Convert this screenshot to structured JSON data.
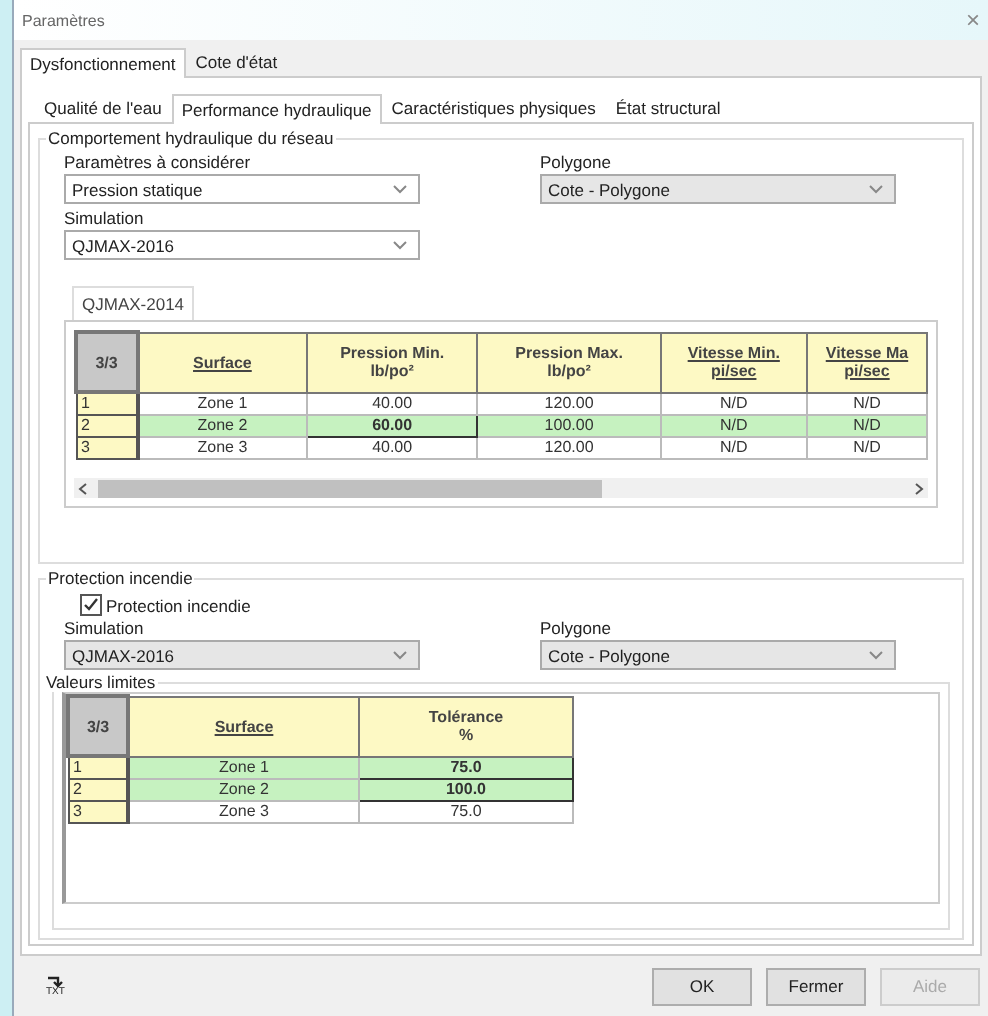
{
  "window": {
    "title": "Paramètres",
    "close": "×"
  },
  "tabs": [
    {
      "label": "Dysfonctionnement",
      "selected": true
    },
    {
      "label": "Cote d'état",
      "selected": false
    }
  ],
  "subtabs": [
    {
      "label": "Qualité de l'eau",
      "selected": false
    },
    {
      "label": "Performance hydraulique",
      "selected": true
    },
    {
      "label": "Caractéristiques physiques",
      "selected": false
    },
    {
      "label": "État structural",
      "selected": false
    }
  ],
  "hydraulic": {
    "title": "Comportement hydraulique du réseau",
    "params": {
      "label": "Paramètres à considérer",
      "value": "Pression statique",
      "disabled": false
    },
    "polygon": {
      "label": "Polygone",
      "value": "Cote - Polygone",
      "disabled": true
    },
    "simulation": {
      "label": "Simulation",
      "value": "QJMAX-2016",
      "disabled": false
    },
    "table_tab": "QJMAX-2014",
    "table": {
      "corner": "3/3",
      "columns": [
        {
          "lines": [
            "Surface"
          ],
          "underlined": true
        },
        {
          "lines": [
            "Pression Min.",
            "lb/po²"
          ],
          "underlined": false
        },
        {
          "lines": [
            "Pression Max.",
            "lb/po²"
          ],
          "underlined": false
        },
        {
          "lines": [
            "Vitesse Min.",
            "pi/sec"
          ],
          "underlined": true
        },
        {
          "lines": [
            "Vitesse Ma",
            "pi/sec"
          ],
          "underlined": true
        }
      ],
      "rows": [
        {
          "index": "1",
          "selected": false,
          "cells": [
            {
              "text": "Zone 1",
              "current": false
            },
            {
              "text": "40.00",
              "current": false
            },
            {
              "text": "120.00",
              "current": false
            },
            {
              "text": "N/D",
              "current": false
            },
            {
              "text": "N/D",
              "current": false
            }
          ]
        },
        {
          "index": "2",
          "selected": true,
          "cells": [
            {
              "text": "Zone 2",
              "current": false
            },
            {
              "text": "60.00",
              "current": true
            },
            {
              "text": "100.00",
              "current": false
            },
            {
              "text": "N/D",
              "current": false
            },
            {
              "text": "N/D",
              "current": false
            }
          ]
        },
        {
          "index": "3",
          "selected": false,
          "cells": [
            {
              "text": "Zone 3",
              "current": false
            },
            {
              "text": "40.00",
              "current": false
            },
            {
              "text": "120.00",
              "current": false
            },
            {
              "text": "N/D",
              "current": false
            },
            {
              "text": "N/D",
              "current": false
            }
          ]
        }
      ]
    }
  },
  "fire": {
    "title": "Protection incendie",
    "checkbox": {
      "label": "Protection incendie",
      "checked": true
    },
    "simulation": {
      "label": "Simulation",
      "value": "QJMAX-2016",
      "disabled": true
    },
    "polygon": {
      "label": "Polygone",
      "value": "Cote - Polygone",
      "disabled": true
    },
    "limits_title": "Valeurs limites",
    "table": {
      "corner": "3/3",
      "columns": [
        {
          "lines": [
            "Surface"
          ],
          "underlined": true
        },
        {
          "lines": [
            "Tolérance",
            "%"
          ],
          "underlined": false
        }
      ],
      "rows": [
        {
          "index": "1",
          "selected": true,
          "cells": [
            {
              "text": "Zone 1",
              "current": false
            },
            {
              "text": "75.0",
              "current": true
            }
          ]
        },
        {
          "index": "2",
          "selected": true,
          "cells": [
            {
              "text": "Zone 2",
              "current": false
            },
            {
              "text": "100.0",
              "current": true
            }
          ]
        },
        {
          "index": "3",
          "selected": false,
          "cells": [
            {
              "text": "Zone 3",
              "current": false
            },
            {
              "text": "75.0",
              "current": false
            }
          ]
        }
      ]
    }
  },
  "buttons": [
    {
      "label": "OK",
      "disabled": false
    },
    {
      "label": "Fermer",
      "disabled": false
    },
    {
      "label": "Aide",
      "disabled": true
    }
  ],
  "txt_icon_label": "TXT"
}
